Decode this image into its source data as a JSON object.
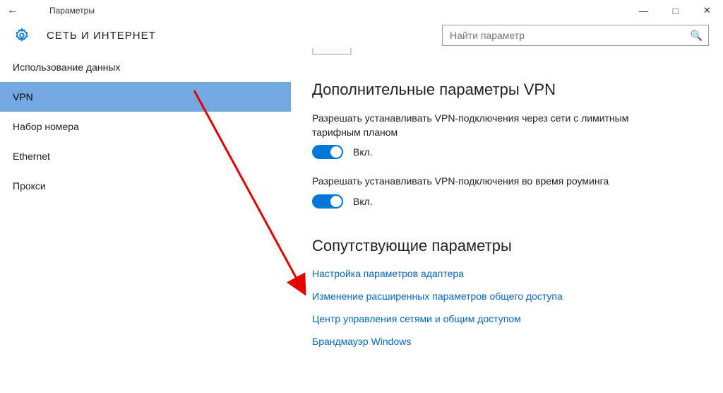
{
  "window": {
    "title": "Параметры"
  },
  "header": {
    "section": "СЕТЬ И ИНТЕРНЕТ",
    "search_placeholder": "Найти параметр"
  },
  "sidebar": {
    "items": [
      {
        "label": "Использование данных"
      },
      {
        "label": "VPN"
      },
      {
        "label": "Набор номера"
      },
      {
        "label": "Ethernet"
      },
      {
        "label": "Прокси"
      }
    ],
    "selected_index": 1
  },
  "content": {
    "advanced_heading": "Дополнительные параметры VPN",
    "settings": [
      {
        "desc": "Разрешать устанавливать VPN-подключения через сети с лимитным тарифным планом",
        "state": "Вкл."
      },
      {
        "desc": "Разрешать устанавливать VPN-подключения во время роуминга",
        "state": "Вкл."
      }
    ],
    "related_heading": "Сопутствующие параметры",
    "links": [
      "Настройка параметров адаптера",
      "Изменение расширенных параметров общего доступа",
      "Центр управления сетями и общим доступом",
      "Брандмауэр Windows"
    ]
  }
}
